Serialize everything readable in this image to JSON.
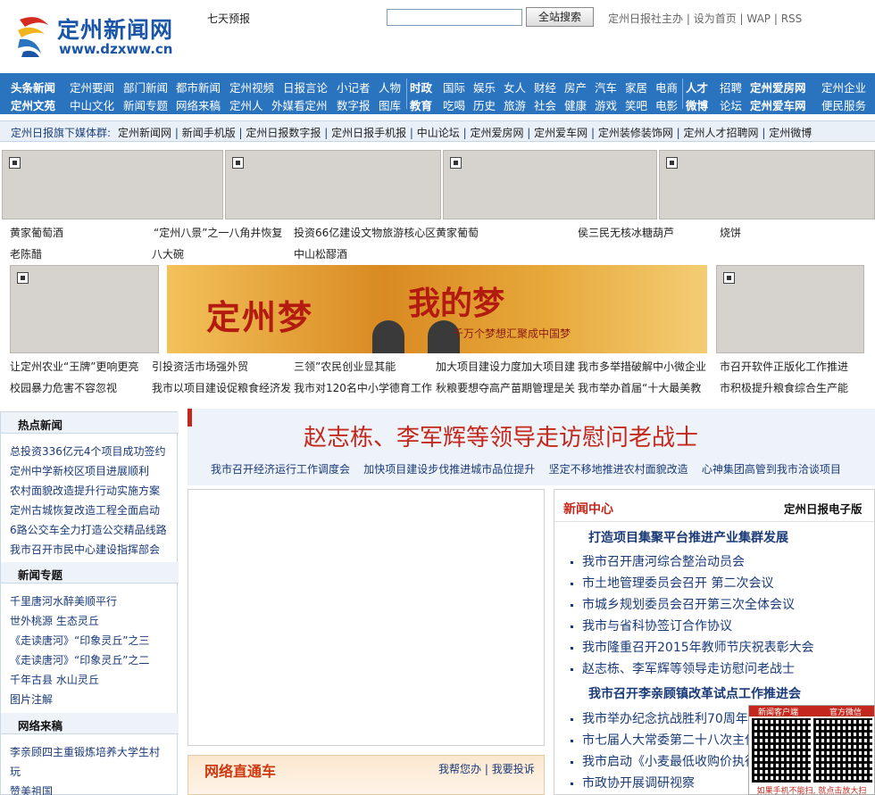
{
  "header": {
    "logo_cn": "定州新闻网",
    "logo_url": "www.dzxww.cn",
    "weather_link": "七天预报",
    "search_button": "全站搜索",
    "search_value": "",
    "toplinks": [
      "定州日报社主办",
      "设为首页",
      "WAP",
      "RSS"
    ]
  },
  "nav": {
    "row1": [
      "头条新闻",
      "定州要闻",
      "部门新闻",
      "都市新闻",
      "定州视频",
      "日报言论",
      "小记者",
      "人物",
      "时政",
      "国际",
      "娱乐",
      "女人",
      "财经",
      "房产",
      "汽车",
      "家居",
      "电商",
      "人才",
      "招聘",
      "定州爱房网",
      "定州企业"
    ],
    "row2": [
      "定州文苑",
      "中山文化",
      "新闻专题",
      "网络来稿",
      "定州人",
      "外媒看定州",
      "数字报",
      "图库",
      "教育",
      "吃喝",
      "历史",
      "旅游",
      "社会",
      "健康",
      "游戏",
      "笑吧",
      "电影",
      "微博",
      "论坛",
      "定州爱车网",
      "便民服务"
    ]
  },
  "media_bar": {
    "label": "定州日报旗下媒体群:",
    "links": [
      "定州新闻网",
      "新闻手机版",
      "定州日报数字报",
      "定州日报手机报",
      "中山论坛",
      "定州爱房网",
      "定州爱车网",
      "定州装修装饰网",
      "定州人才招聘网",
      "定州微博"
    ]
  },
  "photos_row1": {
    "captions_a": [
      "黄家葡萄酒",
      "“定州八景”之一八角井恢复",
      "投资66亿建设文物旅游核心区",
      "黄家葡萄",
      "侯三民无核冰糖葫芦",
      "烧饼"
    ],
    "captions_b": [
      "老陈醋",
      "八大碗",
      "中山松醪酒"
    ]
  },
  "banner": {
    "text1": "定州梦",
    "text2": "我的梦",
    "slogan": "千万个梦想汇聚成中国梦"
  },
  "photos_row2": {
    "captions_a": [
      "让定州农业“王牌”更响更亮",
      "引投资活市场强外贸",
      "三领”农民创业显其能",
      "加大项目建设力度加大项目建",
      "我市多举措破解中小微企业",
      "市召开软件正版化工作推进"
    ],
    "captions_b": [
      "校园暴力危害不容忽视",
      "我市以项目建设促粮食经济发",
      "我市对120名中小学德育工作",
      "秋粮要想夺高产苗期管理是关",
      "我市举办首届“十大最美教",
      "市积极提升粮食综合生产能"
    ]
  },
  "sidebar": {
    "hot_title": "热点新闻",
    "hot_items": [
      "总投资336亿元4个项目成功签约",
      "定州中学新校区项目进展顺利",
      "农村面貌改造提升行动实施方案",
      "定州古城恢复改造工程全面启动",
      "6路公交车全力打造公交精品线路",
      "我市召开市民中心建设指挥部会"
    ],
    "topic_title": "新闻专题",
    "topic_items": [
      "千里唐河水醉美顺平行",
      "世外桃源 生态灵丘",
      "《走读唐河》“印象灵丘”之三",
      "《走读唐河》“印象灵丘”之二",
      "千年古县 水山灵丘",
      "图片注解"
    ],
    "contrib_title": "网络来稿",
    "contrib_items": [
      "李亲顾四主重锻炼培养大学生村",
      "玩",
      "赞美祖国"
    ]
  },
  "headline": {
    "title": "赵志栋、李军辉等领导走访慰问老战士",
    "subs": [
      "我市召开经济运行工作调度会",
      "加快项目建设步伐推进城市品位提升",
      "坚定不移地推进农村面貌改造",
      "心神集团高管到我市洽谈项目"
    ]
  },
  "zhitong": {
    "title": "网络直通车",
    "links": [
      "我帮您办",
      "我要投诉"
    ]
  },
  "news_center": {
    "title": "新闻中心",
    "epaper": "定州日报电子版",
    "group1_title": "打造项目集聚平台推进产业集群发展",
    "group1_items": [
      "我市召开唐河综合整治动员会",
      "市土地管理委员会召开 第二次会议",
      "市城乡规划委员会召开第三次全体会议",
      "我市与省科协签订合作协议",
      "我市隆重召开2015年教师节庆祝表彰大会",
      "赵志栋、李军辉等领导走访慰问老战士"
    ],
    "group2_title": "我市召开李亲顾镇改革试点工作推进会",
    "group2_items": [
      "我市举办纪念抗战胜利70周年",
      "市七届人大常委第二十八次主任",
      "我市启动《小麦最低收购价执行",
      "市政协开展调研视察"
    ]
  },
  "qr": {
    "top_left": "新闻客户端",
    "top_right": "官方微信",
    "bottom": "如果手机不能扫, 就点击放大扫"
  },
  "colors": {
    "nav_blue": "#2a73bf",
    "accent_red": "#c4281c",
    "link_blue": "#1a3a78"
  }
}
